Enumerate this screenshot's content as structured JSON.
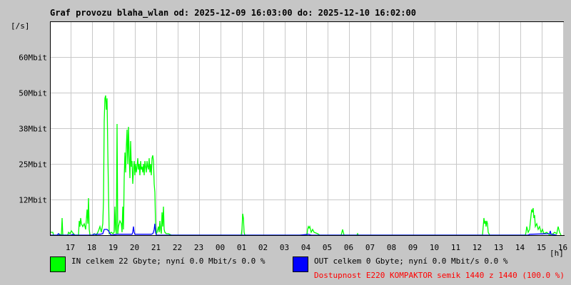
{
  "chart_data": {
    "type": "line",
    "title": "Graf provozu blaha_wlan od: 2025-12-09 16:03:00 do: 2025-12-10 16:02:00",
    "ylabel": "[/s]",
    "xlabel": "[h]",
    "x_unit": "minutes since 2025-12-09 16:03",
    "xlim": [
      0,
      1440
    ],
    "ylim": [
      0,
      75
    ],
    "grid": true,
    "y_ticks": [
      {
        "value": 12.5,
        "label": "12Mbit"
      },
      {
        "value": 25,
        "label": "25Mbit"
      },
      {
        "value": 37.5,
        "label": "38Mbit"
      },
      {
        "value": 50,
        "label": "50Mbit"
      },
      {
        "value": 62.5,
        "label": "60Mbit"
      }
    ],
    "x_ticks": [
      {
        "value": 57,
        "label": "17"
      },
      {
        "value": 117,
        "label": "18"
      },
      {
        "value": 177,
        "label": "19"
      },
      {
        "value": 237,
        "label": "20"
      },
      {
        "value": 297,
        "label": "21"
      },
      {
        "value": 357,
        "label": "22"
      },
      {
        "value": 417,
        "label": "23"
      },
      {
        "value": 477,
        "label": "00"
      },
      {
        "value": 537,
        "label": "01"
      },
      {
        "value": 597,
        "label": "02"
      },
      {
        "value": 657,
        "label": "03"
      },
      {
        "value": 717,
        "label": "04"
      },
      {
        "value": 777,
        "label": "05"
      },
      {
        "value": 837,
        "label": "06"
      },
      {
        "value": 897,
        "label": "07"
      },
      {
        "value": 957,
        "label": "08"
      },
      {
        "value": 1017,
        "label": "09"
      },
      {
        "value": 1077,
        "label": "10"
      },
      {
        "value": 1137,
        "label": "11"
      },
      {
        "value": 1197,
        "label": "12"
      },
      {
        "value": 1257,
        "label": "13"
      },
      {
        "value": 1317,
        "label": "14"
      },
      {
        "value": 1377,
        "label": "15"
      },
      {
        "value": 1437,
        "label": "16"
      }
    ],
    "series": [
      {
        "name": "IN",
        "color": "#00ff00",
        "points": [
          [
            0,
            1
          ],
          [
            8,
            1
          ],
          [
            10,
            0
          ],
          [
            20,
            0
          ],
          [
            24,
            0.5
          ],
          [
            32,
            0
          ],
          [
            34,
            6
          ],
          [
            36,
            0
          ],
          [
            50,
            0
          ],
          [
            52,
            1
          ],
          [
            56,
            0.5
          ],
          [
            60,
            1.5
          ],
          [
            66,
            0.5
          ],
          [
            70,
            0
          ],
          [
            80,
            0
          ],
          [
            82,
            5
          ],
          [
            84,
            3
          ],
          [
            86,
            6
          ],
          [
            88,
            4
          ],
          [
            92,
            3
          ],
          [
            96,
            4
          ],
          [
            100,
            2
          ],
          [
            104,
            9
          ],
          [
            106,
            4
          ],
          [
            108,
            13
          ],
          [
            110,
            2
          ],
          [
            112,
            0
          ],
          [
            120,
            0
          ],
          [
            124,
            0.5
          ],
          [
            130,
            0
          ],
          [
            136,
            1.5
          ],
          [
            140,
            3
          ],
          [
            144,
            1
          ],
          [
            148,
            4
          ],
          [
            150,
            12
          ],
          [
            152,
            40
          ],
          [
            154,
            48
          ],
          [
            156,
            49
          ],
          [
            158,
            44
          ],
          [
            160,
            48
          ],
          [
            162,
            30
          ],
          [
            164,
            15
          ],
          [
            166,
            0.5
          ],
          [
            172,
            1
          ],
          [
            176,
            0.5
          ],
          [
            180,
            1
          ],
          [
            182,
            10
          ],
          [
            184,
            2
          ],
          [
            186,
            0.5
          ],
          [
            188,
            39
          ],
          [
            190,
            0.5
          ],
          [
            192,
            3
          ],
          [
            196,
            5
          ],
          [
            200,
            4
          ],
          [
            202,
            1
          ],
          [
            204,
            10
          ],
          [
            206,
            2
          ],
          [
            208,
            20
          ],
          [
            210,
            29
          ],
          [
            212,
            22
          ],
          [
            214,
            31
          ],
          [
            216,
            37
          ],
          [
            218,
            25
          ],
          [
            220,
            38
          ],
          [
            222,
            28
          ],
          [
            224,
            20
          ],
          [
            226,
            33
          ],
          [
            228,
            24
          ],
          [
            230,
            26
          ],
          [
            232,
            18
          ],
          [
            234,
            23
          ],
          [
            236,
            26
          ],
          [
            238,
            21
          ],
          [
            240,
            25
          ],
          [
            242,
            22
          ],
          [
            244,
            24
          ],
          [
            246,
            27
          ],
          [
            248,
            23
          ],
          [
            250,
            25
          ],
          [
            252,
            21
          ],
          [
            254,
            26
          ],
          [
            256,
            23
          ],
          [
            258,
            24
          ],
          [
            260,
            22
          ],
          [
            262,
            25
          ],
          [
            264,
            21
          ],
          [
            266,
            26
          ],
          [
            268,
            24
          ],
          [
            270,
            22
          ],
          [
            272,
            26
          ],
          [
            274,
            24
          ],
          [
            276,
            23
          ],
          [
            278,
            27
          ],
          [
            280,
            22
          ],
          [
            282,
            25
          ],
          [
            284,
            21
          ],
          [
            286,
            27
          ],
          [
            288,
            28
          ],
          [
            290,
            26
          ],
          [
            292,
            18
          ],
          [
            294,
            15
          ],
          [
            296,
            3
          ],
          [
            298,
            0.5
          ],
          [
            300,
            1
          ],
          [
            304,
            3
          ],
          [
            306,
            1
          ],
          [
            308,
            5
          ],
          [
            310,
            2
          ],
          [
            312,
            0.5
          ],
          [
            314,
            8
          ],
          [
            316,
            3
          ],
          [
            318,
            10
          ],
          [
            320,
            2
          ],
          [
            322,
            1
          ],
          [
            326,
            0.5
          ],
          [
            332,
            0.5
          ],
          [
            340,
            0
          ],
          [
            536,
            0
          ],
          [
            538,
            2
          ],
          [
            540,
            7.5
          ],
          [
            542,
            6
          ],
          [
            544,
            1
          ],
          [
            546,
            0
          ],
          [
            720,
            0
          ],
          [
            722,
            2
          ],
          [
            724,
            3
          ],
          [
            726,
            2.5
          ],
          [
            728,
            3
          ],
          [
            732,
            1
          ],
          [
            736,
            2
          ],
          [
            740,
            1
          ],
          [
            750,
            0.5
          ],
          [
            756,
            0
          ],
          [
            816,
            0
          ],
          [
            818,
            1
          ],
          [
            820,
            2
          ],
          [
            822,
            1
          ],
          [
            824,
            0
          ],
          [
            860,
            0
          ],
          [
            862,
            0.5
          ],
          [
            864,
            0
          ],
          [
            1212,
            0
          ],
          [
            1214,
            3
          ],
          [
            1216,
            6
          ],
          [
            1218,
            4
          ],
          [
            1220,
            5
          ],
          [
            1222,
            3
          ],
          [
            1224,
            5
          ],
          [
            1226,
            4
          ],
          [
            1228,
            1
          ],
          [
            1232,
            0
          ],
          [
            1332,
            0
          ],
          [
            1334,
            1
          ],
          [
            1336,
            3
          ],
          [
            1340,
            1
          ],
          [
            1344,
            2
          ],
          [
            1348,
            7
          ],
          [
            1350,
            9
          ],
          [
            1352,
            8
          ],
          [
            1354,
            9.5
          ],
          [
            1356,
            6
          ],
          [
            1358,
            7
          ],
          [
            1360,
            3
          ],
          [
            1364,
            4
          ],
          [
            1368,
            2
          ],
          [
            1372,
            3
          ],
          [
            1376,
            1
          ],
          [
            1380,
            2
          ],
          [
            1384,
            0.5
          ],
          [
            1392,
            1
          ],
          [
            1400,
            0
          ],
          [
            1410,
            0.5
          ],
          [
            1414,
            1
          ],
          [
            1420,
            0.5
          ],
          [
            1424,
            3
          ],
          [
            1428,
            1
          ],
          [
            1432,
            0
          ]
        ]
      },
      {
        "name": "OUT",
        "color": "#0000ff",
        "points": [
          [
            0,
            0
          ],
          [
            20,
            0
          ],
          [
            24,
            0.5
          ],
          [
            26,
            0
          ],
          [
            60,
            0
          ],
          [
            64,
            0.3
          ],
          [
            68,
            0
          ],
          [
            120,
            0
          ],
          [
            122,
            0.3
          ],
          [
            140,
            0.3
          ],
          [
            148,
            0.5
          ],
          [
            152,
            2
          ],
          [
            160,
            2
          ],
          [
            164,
            1.5
          ],
          [
            168,
            0.5
          ],
          [
            172,
            0
          ],
          [
            188,
            0.3
          ],
          [
            200,
            0.3
          ],
          [
            230,
            0.3
          ],
          [
            232,
            1
          ],
          [
            234,
            3
          ],
          [
            236,
            1
          ],
          [
            238,
            0.3
          ],
          [
            284,
            0.3
          ],
          [
            288,
            0.5
          ],
          [
            290,
            1
          ],
          [
            292,
            2
          ],
          [
            294,
            4
          ],
          [
            296,
            1
          ],
          [
            298,
            0
          ],
          [
            320,
            0
          ],
          [
            700,
            0
          ],
          [
            724,
            0.3
          ],
          [
            732,
            0
          ],
          [
            1340,
            0
          ],
          [
            1344,
            0.3
          ],
          [
            1400,
            0.5
          ],
          [
            1402,
            1.5
          ],
          [
            1404,
            0.3
          ],
          [
            1420,
            0
          ]
        ]
      }
    ]
  },
  "legend": {
    "in_text": "IN celkem 22 Gbyte; nyní    0.0 Mbit/s 0.0 %",
    "out_text": "OUT celkem 0 Gbyte; nyní    0.0 Mbit/s 0.0 %",
    "availability": "Dostupnost E220 KOMPAKTOR semik 1440 z 1440 (100.0 %)",
    "in_color": "#00ff00",
    "out_color": "#0000ff",
    "availability_color": "#ff0000"
  }
}
